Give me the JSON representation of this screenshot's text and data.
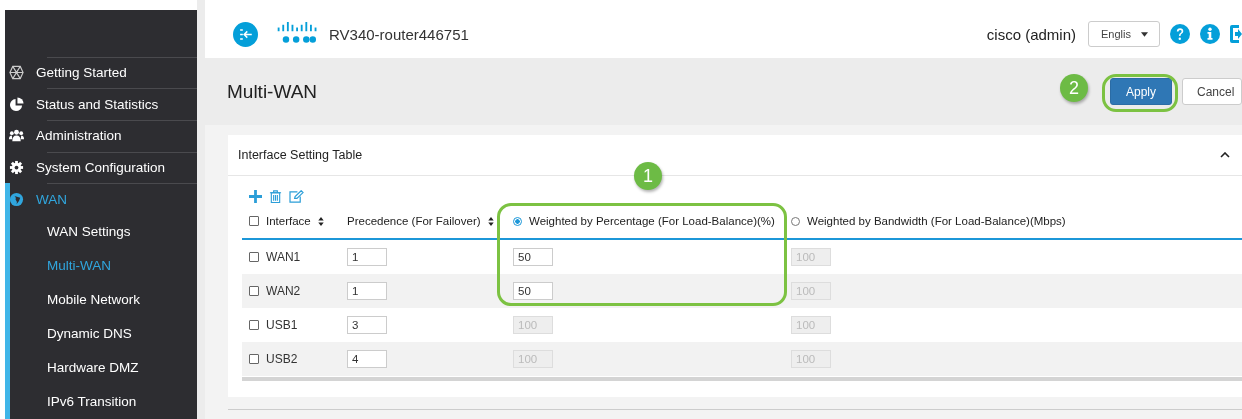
{
  "header": {
    "hostname": "RV340-router446751",
    "user": "cisco (admin)",
    "language": "Englis"
  },
  "sidebar": {
    "items": [
      {
        "label": "Getting Started",
        "selected": false
      },
      {
        "label": "Status and Statistics",
        "selected": false
      },
      {
        "label": "Administration",
        "selected": false
      },
      {
        "label": "System Configuration",
        "selected": false
      },
      {
        "label": "WAN",
        "selected": true,
        "expanded": true,
        "children": [
          {
            "label": "WAN Settings",
            "selected": false
          },
          {
            "label": "Multi-WAN",
            "selected": true
          },
          {
            "label": "Mobile Network",
            "selected": false
          },
          {
            "label": "Dynamic DNS",
            "selected": false
          },
          {
            "label": "Hardware DMZ",
            "selected": false
          },
          {
            "label": "IPv6 Transition",
            "selected": false
          }
        ]
      }
    ]
  },
  "page": {
    "title": "Multi-WAN",
    "buttons": [
      {
        "label": "Apply",
        "kind": "primary"
      },
      {
        "label": "Cancel",
        "kind": "secondary"
      }
    ]
  },
  "panel": {
    "title": "Interface Setting Table",
    "expanded": true,
    "all_checked": false,
    "columns": [
      {
        "label": "Interface",
        "kind": "sortable"
      },
      {
        "label": "Precedence (For Failover)",
        "kind": "sortable"
      },
      {
        "label": "Weighted by Percentage (For Load-Balance)(%)",
        "kind": "radio",
        "selected": true
      },
      {
        "label": "Weighted by Bandwidth (For Load-Balance)(Mbps)",
        "kind": "radio",
        "selected": false
      }
    ],
    "rows": [
      {
        "checked": false,
        "interface": "WAN1",
        "precedence": "1",
        "percentage": {
          "value": "50",
          "disabled": false
        },
        "bandwidth": {
          "value": "100",
          "disabled": true
        }
      },
      {
        "checked": false,
        "interface": "WAN2",
        "precedence": "1",
        "percentage": {
          "value": "50",
          "disabled": false
        },
        "bandwidth": {
          "value": "100",
          "disabled": true
        }
      },
      {
        "checked": false,
        "interface": "USB1",
        "precedence": "3",
        "percentage": {
          "value": "100",
          "disabled": true
        },
        "bandwidth": {
          "value": "100",
          "disabled": true
        }
      },
      {
        "checked": false,
        "interface": "USB2",
        "precedence": "4",
        "percentage": {
          "value": "100",
          "disabled": true
        },
        "bandwidth": {
          "value": "100",
          "disabled": true
        }
      }
    ]
  },
  "annotations": [
    {
      "number": "1"
    },
    {
      "number": "2"
    }
  ]
}
